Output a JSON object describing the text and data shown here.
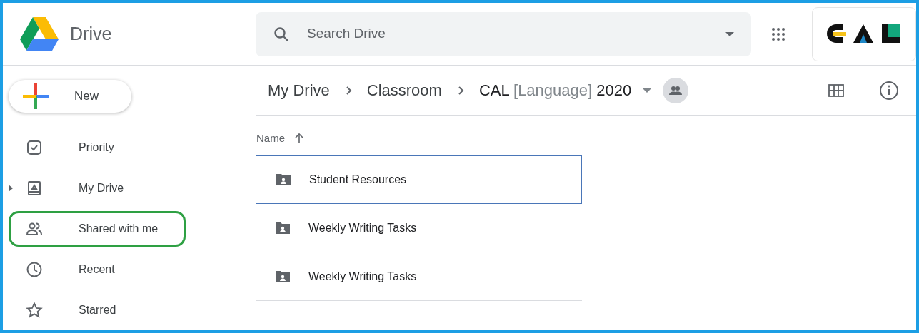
{
  "app": {
    "name": "Drive"
  },
  "search": {
    "placeholder": "Search Drive"
  },
  "new_button": {
    "label": "New"
  },
  "sidebar": {
    "items": [
      {
        "label": "Priority",
        "kind": "priority",
        "expandable": false,
        "highlighted": false
      },
      {
        "label": "My Drive",
        "kind": "drive",
        "expandable": true,
        "highlighted": false
      },
      {
        "label": "Shared with me",
        "kind": "shared",
        "expandable": false,
        "highlighted": true
      },
      {
        "label": "Recent",
        "kind": "recent",
        "expandable": false,
        "highlighted": false
      },
      {
        "label": "Starred",
        "kind": "starred",
        "expandable": false,
        "highlighted": false
      }
    ]
  },
  "breadcrumb": {
    "items": [
      "My Drive",
      "Classroom"
    ],
    "current": [
      {
        "text": "CAL",
        "muted": false
      },
      {
        "text": "[Language]",
        "muted": true
      },
      {
        "text": "2020",
        "muted": false
      }
    ]
  },
  "list": {
    "sort_column": "Name",
    "rows": [
      {
        "name": "Student Resources",
        "selected": true
      },
      {
        "name": "Weekly Writing Tasks",
        "selected": false
      },
      {
        "name": "Weekly Writing Tasks",
        "selected": false
      }
    ]
  }
}
